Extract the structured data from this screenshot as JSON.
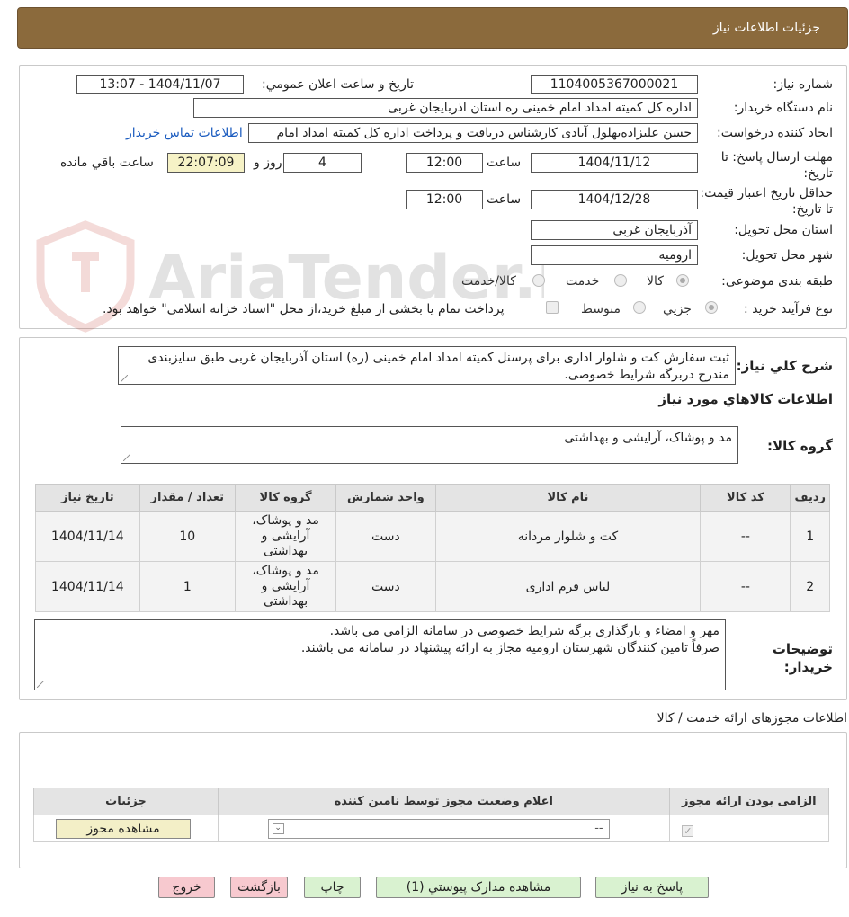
{
  "header": {
    "title": "جزئیات اطلاعات نیاز"
  },
  "watermark": {
    "text": "AriaTender.neT"
  },
  "form": {
    "need_number_label": "شماره نیاز:",
    "need_number": "1104005367000021",
    "announce_label": "تاریخ و ساعت اعلان عمومي:",
    "announce_value": "1404/11/07 - 13:07",
    "buyer_label": "نام دستگاه خریدار:",
    "buyer_value": "اداره کل کمیته امداد امام خمینی  ره  استان اذربایجان غربی",
    "creator_label": "ایجاد کننده درخواست:",
    "creator_value": "حسن علیزاده‌بهلول آبادی کارشناس دریافت و پرداخت اداره کل کمیته امداد امام",
    "contact_link": "اطلاعات تماس خریدار",
    "deadline_label": "مهلت ارسال پاسخ: تا تاریخ:",
    "deadline_date": "1404/11/12",
    "time_label": "ساعت",
    "deadline_time": "12:00",
    "days_value": "4",
    "days_label": "روز و",
    "remaining_time": "22:07:09",
    "remaining_label": "ساعت باقي مانده",
    "validity_label": "حداقل تاریخ اعتبار قیمت: تا تاریخ:",
    "validity_date": "1404/12/28",
    "validity_time": "12:00",
    "province_label": "استان محل تحویل:",
    "province_value": "آذربایجان غربی",
    "city_label": "شهر محل تحویل:",
    "city_value": "ارومیه",
    "category_label": "طبقه بندی موضوعی:",
    "category_options": [
      "کالا",
      "خدمت",
      "کالا/خدمت"
    ],
    "category_selected": "کالا",
    "process_label": "نوع فرآیند خرید :",
    "process_options": [
      "جزیي",
      "متوسط"
    ],
    "process_selected": "جزیي",
    "process_note": "پرداخت تمام یا بخشی از مبلغ خرید،از محل \"اسناد خزانه اسلامی\" خواهد بود."
  },
  "description": {
    "label": "شرح کلي نیاز:",
    "text": "ثبت سفارش کت و شلوار اداری برای پرسنل کمیته امداد امام خمینی (ره) استان آذربایجان غربی طبق سایزبندی مندرج دربرگه شرایط خصوصی."
  },
  "goods": {
    "section_title": "اطلاعات کالاهاي مورد نیاز",
    "group_label": "گروه کالا:",
    "group_value": "مد و پوشاک، آرایشی و بهداشتی",
    "columns": [
      "ردیف",
      "کد کالا",
      "نام کالا",
      "واحد شمارش",
      "گروه کالا",
      "تعداد / مقدار",
      "تاریخ نیاز"
    ],
    "rows": [
      {
        "index": "1",
        "code": "--",
        "name": "کت و شلوار مردانه",
        "unit": "دست",
        "group": "مد و پوشاک، آرایشی و بهداشتی",
        "qty": "10",
        "date": "1404/11/14"
      },
      {
        "index": "2",
        "code": "--",
        "name": "لباس فرم اداری",
        "unit": "دست",
        "group": "مد و پوشاک، آرایشی و بهداشتی",
        "qty": "1",
        "date": "1404/11/14"
      }
    ]
  },
  "buyer_notes": {
    "label": "توضیحات خریدار:",
    "line1": "مهر و امضاء و بارگذاری برگه شرایط خصوصی در سامانه الزامی می باشد.",
    "line2": "صرفاً تامین کنندگان شهرستان ارومیه مجاز به ارائه پیشنهاد در سامانه می باشند."
  },
  "permits": {
    "section_title": "اطلاعات مجوزهای ارائه خدمت / کالا",
    "columns": [
      "الزامی بودن ارائه مجوز",
      "اعلام وضعیت مجوز توسط نامین کننده",
      "جزئیات"
    ],
    "select_value": "--",
    "view_button": "مشاهده مجوز"
  },
  "footer": {
    "reply": "پاسخ به نیاز",
    "attachments": "مشاهده مدارک پیوستي (1)",
    "print": "چاپ",
    "back": "بازگشت",
    "exit": "خروج"
  }
}
